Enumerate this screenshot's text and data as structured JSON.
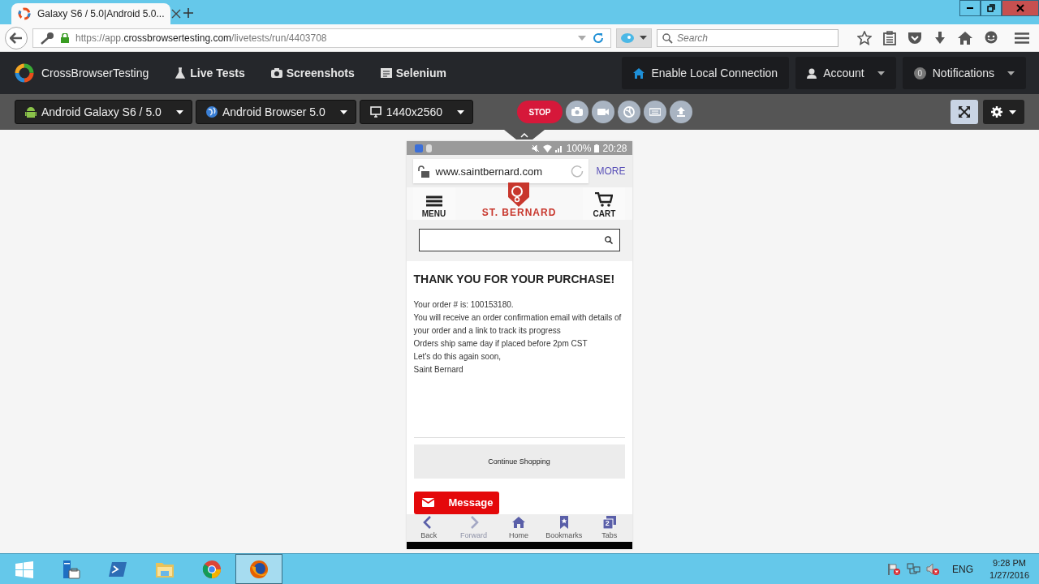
{
  "browser": {
    "tab_title": "Galaxy S6 / 5.0|Android 5.0...",
    "url": "https://app.**crossbrowsertesting.com**/livetests/run/4403708",
    "search": {
      "placeholder": "Search"
    }
  },
  "app_nav": {
    "brand": "CrossBrowserTesting",
    "items": [
      {
        "kind": "flask",
        "label": "Live Tests"
      },
      {
        "kind": "camera",
        "label": "Screenshots"
      },
      {
        "kind": "script",
        "label": "Selenium"
      }
    ],
    "local_connection": "Enable Local Connection",
    "account": "Account",
    "notifications_count": "0",
    "notifications": "Notifications"
  },
  "toolbar": {
    "dropdowns": [
      {
        "kind": "android",
        "label": "Android Galaxy S6 / 5.0"
      },
      {
        "kind": "globe",
        "label": "Android Browser 5.0"
      },
      {
        "kind": "monitor",
        "label": "1440x2560"
      }
    ],
    "stop": "STOP",
    "fullscreen": {
      "selected": true
    }
  },
  "phone": {
    "status": {
      "battery": "100%",
      "time": "20:28"
    },
    "address": {
      "url": "www.saintbernard.com",
      "more": "MORE"
    },
    "header": {
      "menu": "MENU",
      "logo": "ST. BERNARD",
      "cart": "CART"
    },
    "heading": "THANK YOU FOR YOUR PURCHASE!",
    "lines": [
      "Your order # is: 100153180.",
      "You will receive an order confirmation email with details of your order and a link to track its progress",
      "Orders ship same day if placed before 2pm CST",
      "Let's do this again soon,",
      "Saint Bernard"
    ],
    "continue_button": "Continue Shopping",
    "message_button": "Message",
    "bottom_nav": [
      {
        "kind": "back",
        "label": "Back",
        "disabled": false
      },
      {
        "kind": "forward",
        "label": "Forward",
        "disabled": true
      },
      {
        "kind": "home",
        "label": "Home",
        "disabled": false
      },
      {
        "kind": "bookmarks",
        "label": "Bookmarks",
        "disabled": false
      },
      {
        "kind": "tabs",
        "label": "Tabs",
        "disabled": false,
        "badge": "2"
      }
    ]
  },
  "taskbar": {
    "apps": [
      {
        "kind": "start",
        "selected": false
      },
      {
        "kind": "server",
        "selected": false
      },
      {
        "kind": "shell",
        "selected": false
      },
      {
        "kind": "folder",
        "selected": false
      },
      {
        "kind": "chrome",
        "selected": false
      },
      {
        "kind": "firefox",
        "selected": true
      }
    ],
    "language": "ENG",
    "time": "9:28 PM",
    "date": "1/27/2016"
  }
}
